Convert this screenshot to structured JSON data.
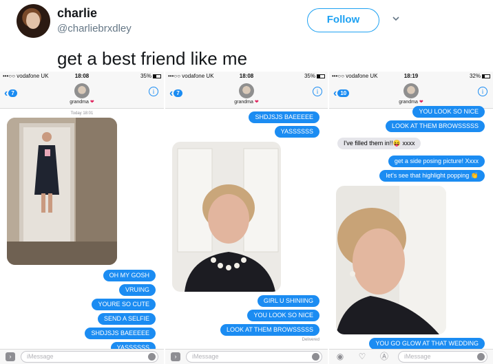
{
  "tweet": {
    "name": "charlie",
    "handle": "@charliebrxdley",
    "follow_label": "Follow",
    "text": "get a best friend like me"
  },
  "screens": [
    {
      "carrier": "•••○○ vodafone UK",
      "time": "18:08",
      "battery": "35%",
      "back_count": "7",
      "contact": "grandma",
      "today": "Today 18:01",
      "bubbles": [
        "OH MY GOSH",
        "VRUING",
        "YOURE SO CUTE",
        "SEND A SELFIE",
        "SHDJSJS BAEEEEE",
        "YASSSSSS"
      ],
      "placeholder": "iMessage"
    },
    {
      "carrier": "•••○○ vodafone UK",
      "time": "18:08",
      "battery": "35%",
      "back_count": "7",
      "contact": "grandma",
      "bubbles_top": [
        "SHDJSJS BAEEEEE",
        "YASSSSSS"
      ],
      "bubbles_bottom": [
        "GIRL U SHINIING",
        "YOU LOOK SO NICE",
        "LOOK AT THEM BROWSSSSS"
      ],
      "delivered": "Delivered",
      "placeholder": "iMessage"
    },
    {
      "carrier": "•••○○ vodafone UK",
      "time": "18:19",
      "battery": "32%",
      "back_count": "10",
      "contact": "grandma",
      "bubbles_top": [
        "YOU LOOK SO NICE",
        "LOOK AT THEM BROWSSSSS"
      ],
      "grey": "I've filled them in!!😝 xxxx",
      "bubbles_mid": [
        "get a side posing picture! Xxxx",
        "let's see that highlight popping 👏"
      ],
      "bubble_bottom": "YOU GO GLOW AT THAT WEDDING",
      "placeholder": "iMessage"
    }
  ],
  "colors": {
    "twitter_blue": "#1da1f2",
    "imessage_blue": "#1b8cf2",
    "heart": "#e0245e"
  }
}
